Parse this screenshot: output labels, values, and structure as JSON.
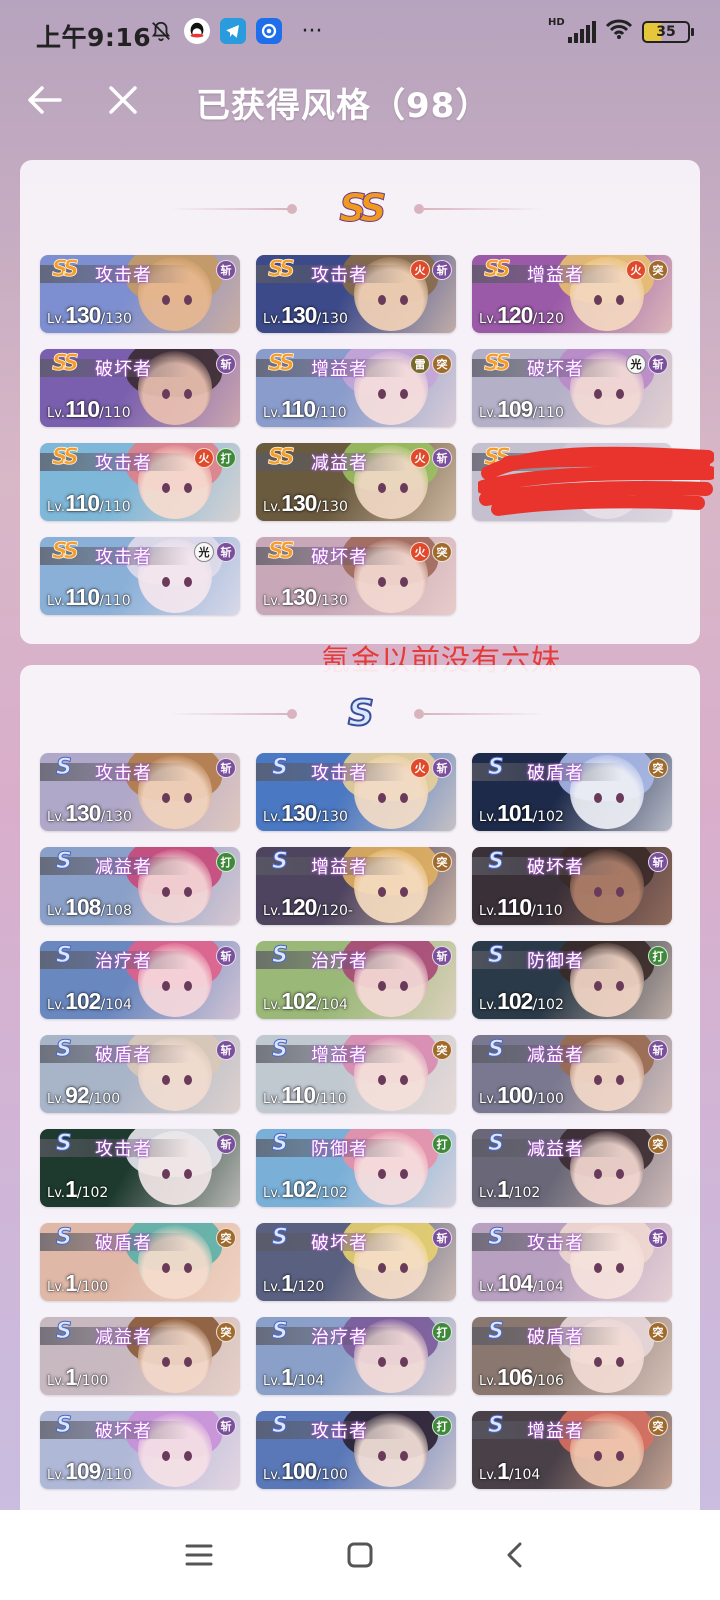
{
  "status_bar": {
    "time": "上午9:16",
    "network": "HD",
    "battery": "35",
    "more": "···",
    "left_icons": [
      "bell-off-icon",
      "qq-icon",
      "telegram-icon",
      "app-icon"
    ],
    "right_icons": [
      "signal-icon",
      "wifi-icon",
      "battery-icon"
    ]
  },
  "header": {
    "title": "已获得风格（98）"
  },
  "sections": {
    "ss": {
      "rank": "SS"
    },
    "s": {
      "rank": "S"
    }
  },
  "annotation": "氪金以前没有六妹",
  "cards_ss": [
    {
      "rank": "SS",
      "role": "攻击者",
      "lv": "130",
      "max": "/130",
      "attrs": [
        "斩"
      ],
      "colors": [
        "#7d8fd0",
        "#e8b890",
        "#c79a63"
      ]
    },
    {
      "rank": "SS",
      "role": "攻击者",
      "lv": "130",
      "max": "/130",
      "attrs": [
        "火",
        "斩"
      ],
      "colors": [
        "#3c4a8a",
        "#f2d2b6",
        "#8a6a48"
      ]
    },
    {
      "rank": "SS",
      "role": "增益者",
      "lv": "120",
      "max": "/120",
      "attrs": [
        "火",
        "突"
      ],
      "colors": [
        "#9a5aa8",
        "#f4d8c0",
        "#e8c070"
      ]
    },
    {
      "rank": "SS",
      "role": "破坏者",
      "lv": "110",
      "max": "/110",
      "attrs": [
        "斩"
      ],
      "colors": [
        "#7a5fae",
        "#eac0b0",
        "#3a2a30"
      ]
    },
    {
      "rank": "SS",
      "role": "增益者",
      "lv": "110",
      "max": "/110",
      "attrs": [
        "雷",
        "突"
      ],
      "colors": [
        "#8a9ccc",
        "#f6dedc",
        "#c5a5d8"
      ]
    },
    {
      "rank": "SS",
      "role": "破坏者",
      "lv": "109",
      "max": "/110",
      "attrs": [
        "光",
        "斩"
      ],
      "colors": [
        "#b4b0c8",
        "#f3dbd5",
        "#b98ac8"
      ]
    },
    {
      "rank": "SS",
      "role": "攻击者",
      "lv": "110",
      "max": "/110",
      "attrs": [
        "火",
        "打"
      ],
      "colors": [
        "#7fb7d8",
        "#f7dcd0",
        "#e07f88"
      ]
    },
    {
      "rank": "SS",
      "role": "减益者",
      "lv": "130",
      "max": "/130",
      "attrs": [
        "火",
        "斩"
      ],
      "colors": [
        "#6a5a3e",
        "#f1d8c5",
        "#9ac060"
      ]
    },
    {
      "rank": "SS",
      "role": "",
      "lv": "",
      "max": "",
      "attrs": [],
      "colors": [
        "#c5c0d0",
        "#e8e0e8",
        "#d0c8d8"
      ],
      "redacted": true
    },
    {
      "rank": "SS",
      "role": "攻击者",
      "lv": "110",
      "max": "/110",
      "attrs": [
        "光",
        "斩"
      ],
      "colors": [
        "#8ab0d8",
        "#f5e6ee",
        "#e0dcea"
      ]
    },
    {
      "rank": "SS",
      "role": "破坏者",
      "lv": "130",
      "max": "/130",
      "attrs": [
        "火",
        "突"
      ],
      "colors": [
        "#c8a8b8",
        "#f3d8d0",
        "#a0685a"
      ]
    }
  ],
  "cards_s": [
    {
      "rank": "S",
      "role": "攻击者",
      "lv": "130",
      "max": "/130",
      "attrs": [
        "斩"
      ],
      "colors": [
        "#b0a8c8",
        "#f1d3bc",
        "#b27a48"
      ]
    },
    {
      "rank": "S",
      "role": "攻击者",
      "lv": "130",
      "max": "/130",
      "attrs": [
        "火",
        "斩"
      ],
      "colors": [
        "#4a78c2",
        "#f3dcc6",
        "#e8cf9a"
      ]
    },
    {
      "rank": "S",
      "role": "破盾者",
      "lv": "101",
      "max": "/102",
      "attrs": [
        "突"
      ],
      "colors": [
        "#1e2a4a",
        "#eef0f6",
        "#a8b8e8"
      ]
    },
    {
      "rank": "S",
      "role": "减益者",
      "lv": "108",
      "max": "/108",
      "attrs": [
        "打"
      ],
      "colors": [
        "#8aa0c8",
        "#f4d6d6",
        "#c8487a"
      ]
    },
    {
      "rank": "S",
      "role": "增益者",
      "lv": "120",
      "max": "/120-",
      "attrs": [
        "突"
      ],
      "colors": [
        "#4e4460",
        "#f5dcc0",
        "#e0b060"
      ]
    },
    {
      "rank": "S",
      "role": "破坏者",
      "lv": "110",
      "max": "/110",
      "attrs": [
        "斩"
      ],
      "colors": [
        "#3a3038",
        "#b0806a",
        "#3a2a28"
      ]
    },
    {
      "rank": "S",
      "role": "治疗者",
      "lv": "102",
      "max": "/104",
      "attrs": [
        "斩"
      ],
      "colors": [
        "#6a88c0",
        "#f6d8dc",
        "#e0608a"
      ]
    },
    {
      "rank": "S",
      "role": "治疗者",
      "lv": "102",
      "max": "/104",
      "attrs": [
        "斩"
      ],
      "colors": [
        "#9ab878",
        "#f4dad6",
        "#a84878"
      ]
    },
    {
      "rank": "S",
      "role": "防御者",
      "lv": "102",
      "max": "/102",
      "attrs": [
        "打"
      ],
      "colors": [
        "#2a3a48",
        "#f3d6c6",
        "#3a2a28"
      ]
    },
    {
      "rank": "S",
      "role": "破盾者",
      "lv": "92",
      "max": "/100",
      "attrs": [
        "斩"
      ],
      "colors": [
        "#a8b4c8",
        "#f1dcd0",
        "#d8c8b8"
      ]
    },
    {
      "rank": "S",
      "role": "增益者",
      "lv": "110",
      "max": "/110",
      "attrs": [
        "突"
      ],
      "colors": [
        "#c0c8d0",
        "#f5e0da",
        "#d88ab0"
      ]
    },
    {
      "rank": "S",
      "role": "减益者",
      "lv": "100",
      "max": "/100",
      "attrs": [
        "斩"
      ],
      "colors": [
        "#7a7890",
        "#f2d8c8",
        "#9a6a50"
      ]
    },
    {
      "rank": "S",
      "role": "攻击者",
      "lv": "1",
      "max": "/102",
      "attrs": [
        "斩"
      ],
      "colors": [
        "#1e3a2e",
        "#f1e6e6",
        "#e8e8ee"
      ]
    },
    {
      "rank": "S",
      "role": "防御者",
      "lv": "102",
      "max": "/102",
      "attrs": [
        "打"
      ],
      "colors": [
        "#7ab0d8",
        "#f6dede",
        "#e890a8"
      ]
    },
    {
      "rank": "S",
      "role": "减益者",
      "lv": "1",
      "max": "/102",
      "attrs": [
        "突"
      ],
      "colors": [
        "#6a6878",
        "#f3d8d0",
        "#3a2a30"
      ]
    },
    {
      "rank": "S",
      "role": "破盾者",
      "lv": "1",
      "max": "/100",
      "attrs": [
        "突"
      ],
      "colors": [
        "#e0b8a8",
        "#f5dccc",
        "#5ab0a8"
      ]
    },
    {
      "rank": "S",
      "role": "破坏者",
      "lv": "1",
      "max": "/120",
      "attrs": [
        "斩"
      ],
      "colors": [
        "#5a6080",
        "#f6dec8",
        "#e8d070"
      ]
    },
    {
      "rank": "S",
      "role": "攻击者",
      "lv": "104",
      "max": "/104",
      "attrs": [
        "斩"
      ],
      "colors": [
        "#b8a0c0",
        "#f6e2dc",
        "#f0d8d0"
      ]
    },
    {
      "rank": "S",
      "role": "减益者",
      "lv": "1",
      "max": "/100",
      "attrs": [
        "突"
      ],
      "colors": [
        "#c8b8c0",
        "#f3d8c8",
        "#8a5a38"
      ]
    },
    {
      "rank": "S",
      "role": "治疗者",
      "lv": "1",
      "max": "/104",
      "attrs": [
        "打"
      ],
      "colors": [
        "#8aa0c8",
        "#f4dcd8",
        "#7a5a9a"
      ]
    },
    {
      "rank": "S",
      "role": "破盾者",
      "lv": "106",
      "max": "/106",
      "attrs": [
        "突"
      ],
      "colors": [
        "#8a7870",
        "#f3dcd4",
        "#e8d8dc"
      ]
    },
    {
      "rank": "S",
      "role": "破坏者",
      "lv": "109",
      "max": "/110",
      "attrs": [
        "斩"
      ],
      "colors": [
        "#b0b8d8",
        "#f6e0e6",
        "#c890d8"
      ]
    },
    {
      "rank": "S",
      "role": "攻击者",
      "lv": "100",
      "max": "/100",
      "attrs": [
        "打"
      ],
      "colors": [
        "#5a78b8",
        "#f4e0d8",
        "#2a2030"
      ]
    },
    {
      "rank": "S",
      "role": "增益者",
      "lv": "1",
      "max": "/104",
      "attrs": [
        "突"
      ],
      "colors": [
        "#4a4048",
        "#f0c8b0",
        "#d87060"
      ]
    }
  ],
  "attribute_styles": {
    "斩": "slash",
    "突": "thrust",
    "打": "strike",
    "火": "fire",
    "雷": "thunder",
    "光": "light"
  },
  "card_lv_prefix": "Lv.",
  "nav": {
    "menu": "menu-icon",
    "home": "home-icon",
    "back": "back-nav-icon"
  }
}
